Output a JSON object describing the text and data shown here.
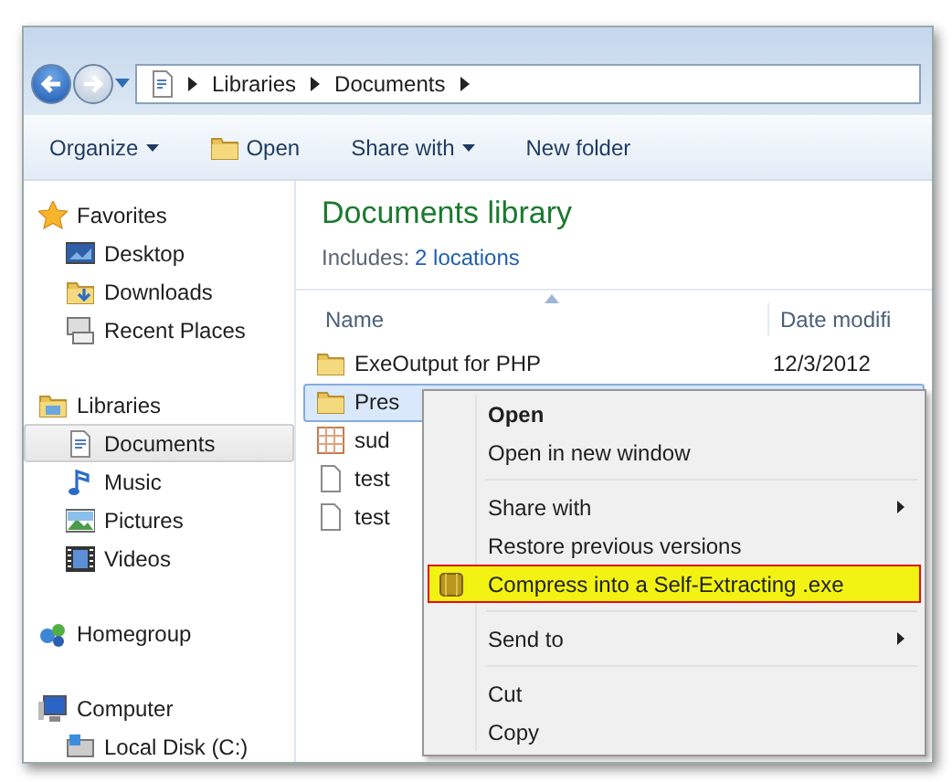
{
  "address": {
    "segments": [
      "Libraries",
      "Documents"
    ]
  },
  "toolbar": [
    {
      "label": "Organize",
      "kind": "dropdown"
    },
    {
      "label": "Open",
      "kind": "icon"
    },
    {
      "label": "Share with",
      "kind": "dropdown"
    },
    {
      "label": "New folder",
      "kind": "plain"
    }
  ],
  "sidebar": {
    "sections": [
      {
        "label": "Favorites",
        "items": [
          {
            "label": "Desktop",
            "selected": false
          },
          {
            "label": "Downloads",
            "selected": false
          },
          {
            "label": "Recent Places",
            "selected": false
          }
        ]
      },
      {
        "label": "Libraries",
        "items": [
          {
            "label": "Documents",
            "selected": true
          },
          {
            "label": "Music",
            "selected": false
          },
          {
            "label": "Pictures",
            "selected": false
          },
          {
            "label": "Videos",
            "selected": false
          }
        ]
      },
      {
        "label": "Homegroup"
      },
      {
        "label": "Computer",
        "items": [
          {
            "label": "Local Disk (C:)",
            "selected": false
          }
        ]
      }
    ]
  },
  "library": {
    "title": "Documents library",
    "includes_label": "Includes:",
    "includes_link": "2 locations"
  },
  "table": {
    "columns": [
      "Name",
      "Date modifi"
    ],
    "rows": [
      {
        "kind": "folder",
        "name": "ExeOutput for PHP",
        "date": "12/3/2012",
        "selected": false
      },
      {
        "kind": "folder",
        "name": "Pres",
        "date": "",
        "selected": true
      },
      {
        "kind": "grid",
        "name": "sud",
        "date": "",
        "selected": false
      },
      {
        "kind": "file",
        "name": "test",
        "date": "",
        "selected": false
      },
      {
        "kind": "file",
        "name": "test",
        "date": "",
        "selected": false
      }
    ]
  },
  "context_menu": {
    "items": [
      {
        "kind": "item",
        "label": "Open",
        "bold": true,
        "submenu": false,
        "selected": false
      },
      {
        "kind": "item",
        "label": "Open in new window",
        "bold": false,
        "submenu": false,
        "selected": false
      },
      {
        "kind": "separator"
      },
      {
        "kind": "item",
        "label": "Share with",
        "bold": false,
        "submenu": true,
        "selected": false
      },
      {
        "kind": "item",
        "label": "Restore previous versions",
        "bold": false,
        "submenu": false,
        "selected": false
      },
      {
        "kind": "item",
        "label": "Compress into a Self-Extracting .exe",
        "bold": false,
        "submenu": false,
        "selected": true
      },
      {
        "kind": "separator"
      },
      {
        "kind": "item",
        "label": "Send to",
        "bold": false,
        "submenu": true,
        "selected": false
      },
      {
        "kind": "separator"
      },
      {
        "kind": "item",
        "label": "Cut",
        "bold": false,
        "submenu": false,
        "selected": false
      },
      {
        "kind": "item",
        "label": "Copy",
        "bold": false,
        "submenu": false,
        "selected": false
      }
    ]
  }
}
